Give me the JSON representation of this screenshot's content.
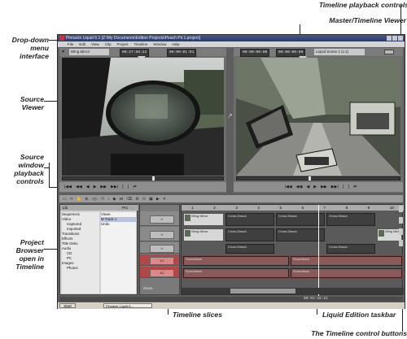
{
  "annotations": {
    "dropdown_menu": "Drop-down\nmenu\ninterface",
    "source_viewer": "Source\nViewer",
    "source_window_playback": "Source\nwindow\nplayback\ncontrols",
    "project_browser": "Project\nBrowser\nopen in\nTimeline",
    "timeline_playback": "Timeline playback controls",
    "master_viewer": "Master/Timeline Viewer",
    "timeline_slices": "Timeline slices",
    "liquid_taskbar": "Liquid Edition taskbar",
    "control_buttons": "The Timeline control buttons"
  },
  "window": {
    "title": "Pinnacle Liquid 6.1 [Z:\\My Documents\\Edition Projects\\Peach Pit.1.project]",
    "menus": [
      "File",
      "Edit",
      "View",
      "Clip",
      "Project",
      "Timeline",
      "Window",
      "Help"
    ]
  },
  "source": {
    "dropdown": "Wing Mirror",
    "tc_in": "00:27:58:22",
    "tc_dur": "00:00:01:01",
    "transport": [
      "|◀◀",
      "◀◀",
      "◀",
      "▶",
      "▶▶",
      "▶▶|",
      "{",
      "}",
      "⇄"
    ]
  },
  "master": {
    "tc_a": "00:00:00:00",
    "tc_b": "00:00:00:00",
    "dropdown": "Liquid Scene 1 (1:1)",
    "transport": [
      "|◀◀",
      "◀◀",
      "◀",
      "▶",
      "▶▶",
      "▶▶|",
      "{",
      "}",
      "⇄"
    ]
  },
  "browser": {
    "tree": [
      "Sequences",
      "Video",
      "Captured",
      "Imported",
      "Transitions",
      "Effects",
      "Title Deko",
      "Audio",
      "CD",
      "PC",
      "Images",
      "Photos"
    ],
    "racks": [
      "Views",
      "M Track 1",
      "Undo"
    ],
    "tabs": [
      "Lib",
      "Pro"
    ]
  },
  "timeline": {
    "ruler": [
      "1",
      "2",
      "3",
      "4",
      "5",
      "6",
      "7",
      "8",
      "9",
      "10"
    ],
    "tracks": [
      {
        "name": "V",
        "clips": [
          "Wing Mirror",
          "Cross Dissol.",
          "Cross Dissol.",
          "Cross Dissol."
        ]
      },
      {
        "name": "V",
        "clips": [
          "Wing Mirror",
          "Cross Dissol.",
          "Cross Dissol.",
          "Wing Mirror"
        ]
      },
      {
        "name": "V",
        "clips": [
          "Cross Dissol.",
          "Cross Dissol."
        ]
      },
      {
        "name": "A1",
        "clips": [
          "Soundtrack",
          "Soundtrack"
        ]
      },
      {
        "name": "A2",
        "clips": [
          "Soundtrack",
          "Soundtrack"
        ]
      }
    ],
    "tc": "00:01:32:21",
    "zoom": "Zoom"
  },
  "taskbar": {
    "start": "Start",
    "app": "Pinnacle Liquid 6..."
  }
}
